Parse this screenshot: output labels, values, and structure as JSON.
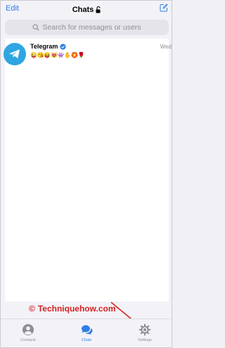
{
  "header": {
    "edit_label": "Edit",
    "title": "Chats",
    "lock_icon": "unlock-icon",
    "compose_icon": "compose-icon"
  },
  "search": {
    "placeholder": "Search for messages or users",
    "icon": "search-icon"
  },
  "chats": [
    {
      "name": "Telegram",
      "verified": true,
      "time": "Wed",
      "preview": "😜😘😝😻👾✋🏵️🌹",
      "avatar_color": "#2ea6e2"
    }
  ],
  "watermark": {
    "symbol": "©",
    "text": "Techniquehow.com",
    "color": "#d42020"
  },
  "tabbar": {
    "tabs": [
      {
        "label": "Contacts",
        "icon": "contacts-icon",
        "active": false
      },
      {
        "label": "Chats",
        "icon": "chats-icon",
        "active": true
      },
      {
        "label": "Settings",
        "icon": "settings-icon",
        "active": false
      }
    ]
  },
  "colors": {
    "accent": "#2f7fe6",
    "annotation": "#d42020"
  }
}
